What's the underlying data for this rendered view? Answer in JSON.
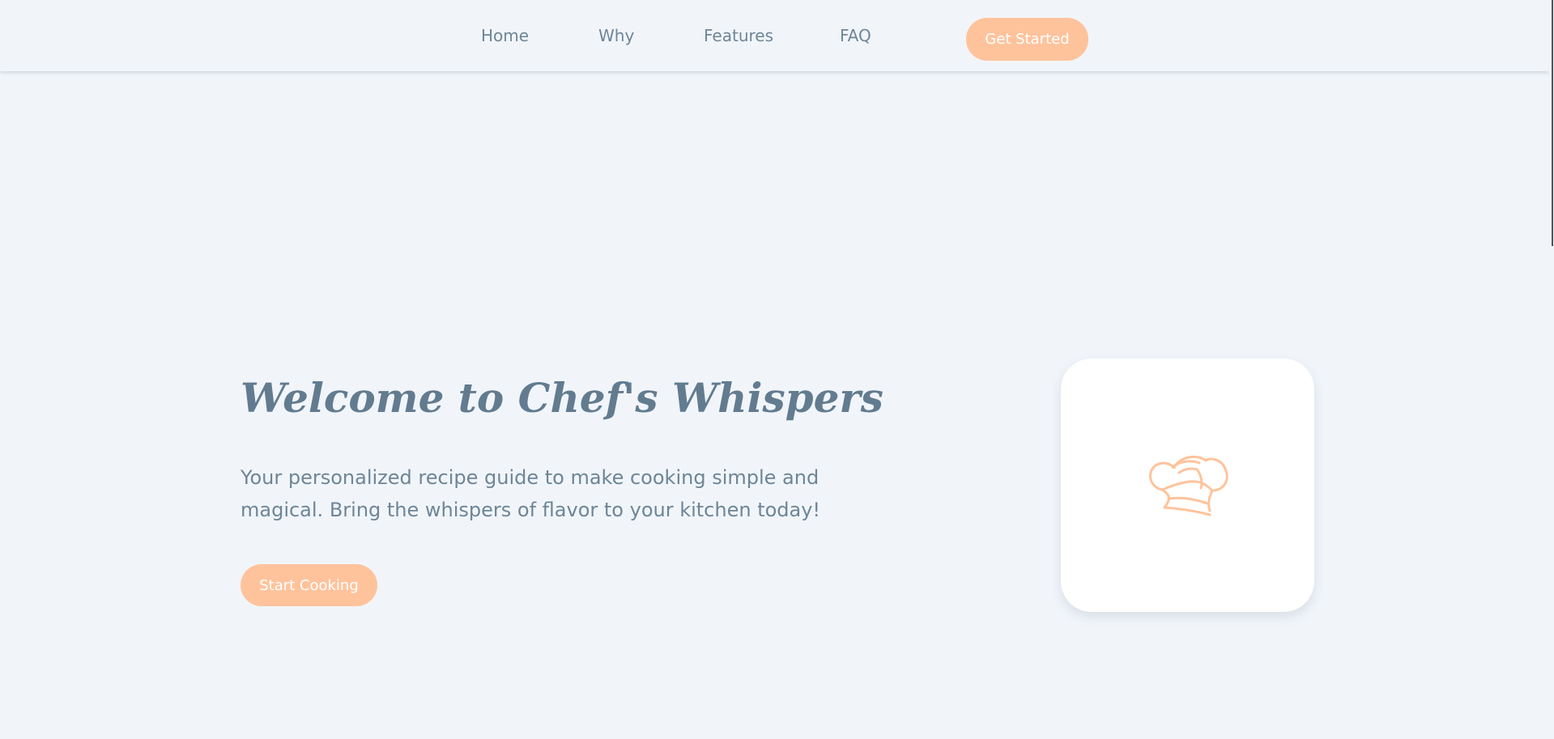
{
  "nav": {
    "items": [
      {
        "label": "Home"
      },
      {
        "label": "Why"
      },
      {
        "label": "Features"
      },
      {
        "label": "FAQ"
      }
    ],
    "cta_label": "Get Started"
  },
  "hero": {
    "title": "Welcome to Chef's Whispers",
    "subtitle": "Your personalized recipe guide to make cooking simple and magical. Bring the whispers of flavor to your kitchen today!",
    "button_label": "Start Cooking",
    "image_icon": "chef-hat-icon"
  },
  "colors": {
    "background": "#f1f5fa",
    "accent": "#ffc39c",
    "text": "#6e8597",
    "heading": "#627b8f",
    "card": "#ffffff"
  }
}
